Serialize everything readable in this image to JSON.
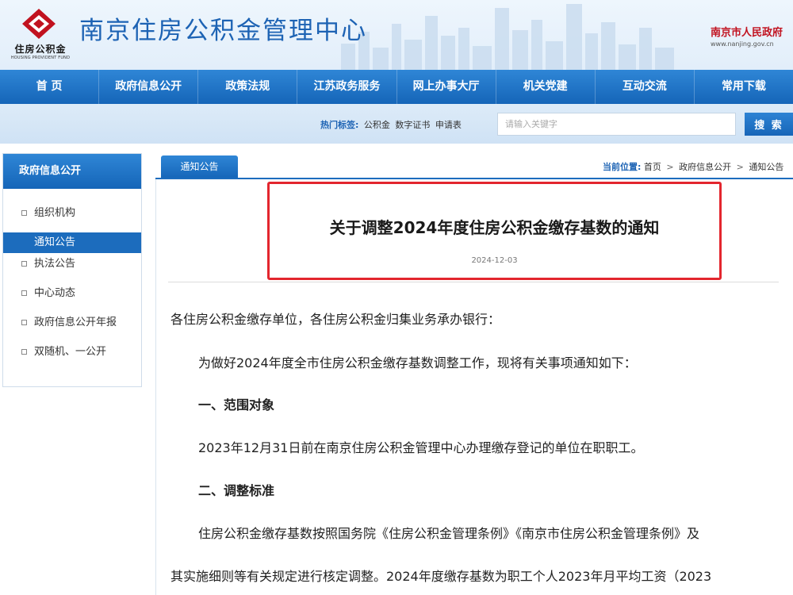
{
  "header": {
    "logo_cn": "住房公积金",
    "logo_en": "HOUSING PROVIDENT FUND",
    "site_title": "南京住房公积金管理中心",
    "gov_name": "南京市人民政府",
    "gov_url": "www.nanjing.gov.cn",
    "colors": {
      "brand_blue": "#1d63b4",
      "logo_red": "#c1121f"
    }
  },
  "nav": {
    "items": [
      "首 页",
      "政府信息公开",
      "政策法规",
      "江苏政务服务",
      "网上办事大厅",
      "机关党建",
      "互动交流",
      "常用下载"
    ]
  },
  "search": {
    "hot_label": "热门标签:",
    "hot_tags": [
      "公积金",
      "数字证书",
      "申请表"
    ],
    "placeholder": "请输入关键字",
    "button_label": "搜 索"
  },
  "sidebar": {
    "title": "政府信息公开",
    "items": [
      {
        "label": "组织机构",
        "active": false
      },
      {
        "label": "通知公告",
        "active": true
      },
      {
        "label": "执法公告",
        "active": false
      },
      {
        "label": "中心动态",
        "active": false
      },
      {
        "label": "政府信息公开年报",
        "active": false
      },
      {
        "label": "双随机、一公开",
        "active": false
      }
    ]
  },
  "content": {
    "tab_label": "通知公告",
    "breadcrumb": {
      "label": "当前位置:",
      "items": [
        "首页",
        "政府信息公开",
        "通知公告"
      ],
      "separator": ">"
    },
    "article": {
      "title": "关于调整2024年度住房公积金缴存基数的通知",
      "date": "2024-12-03",
      "paragraphs": [
        "各住房公积金缴存单位，各住房公积金归集业务承办银行：",
        "为做好2024年度全市住房公积金缴存基数调整工作，现将有关事项通知如下：",
        "一、范围对象",
        "2023年12月31日前在南京住房公积金管理中心办理缴存登记的单位在职职工。",
        "二、调整标准",
        "住房公积金缴存基数按照国务院《住房公积金管理条例》《南京市住房公积金管理条例》及",
        "其实施细则等有关规定进行核定调整。2024年度缴存基数为职工个人2023年月平均工资（2023"
      ]
    }
  }
}
